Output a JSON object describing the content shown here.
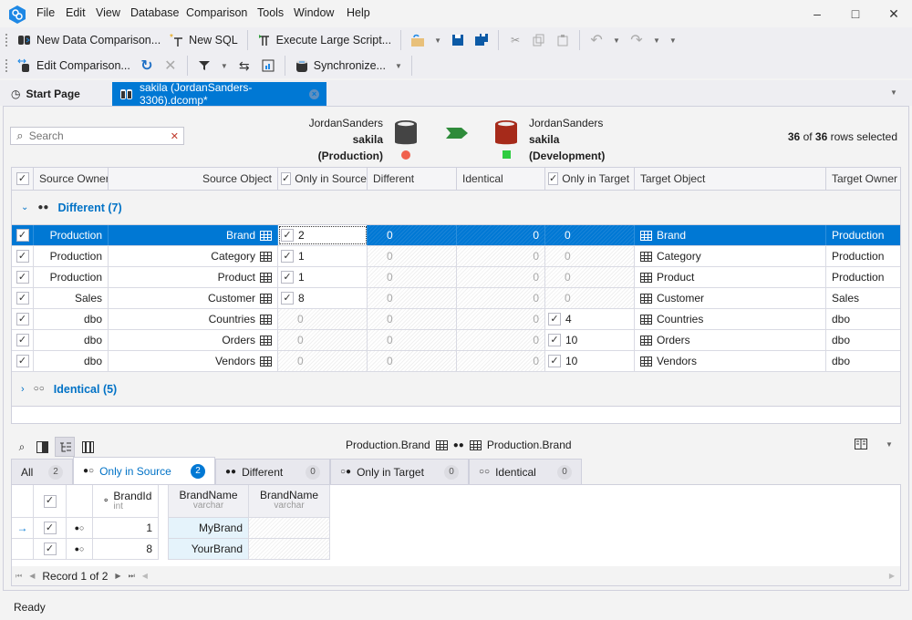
{
  "menu": [
    "File",
    "Edit",
    "View",
    "Database",
    "Comparison",
    "Tools",
    "Window",
    "Help"
  ],
  "toolbar1": {
    "new_data_comparison": "New Data Comparison...",
    "new_sql": "New SQL",
    "execute_large_script": "Execute Large Script..."
  },
  "toolbar2": {
    "edit_comparison": "Edit Comparison...",
    "synchronize": "Synchronize..."
  },
  "tabs": {
    "start_page": "Start Page",
    "active": "sakila (JordanSanders-3306).dcomp*"
  },
  "search": {
    "placeholder": "Search"
  },
  "source": {
    "server": "JordanSanders",
    "database": "sakila",
    "env": "(Production)",
    "status_color": "#f0604d"
  },
  "target": {
    "server": "JordanSanders",
    "database": "sakila",
    "env": "(Development)",
    "status_color": "#2ecc40"
  },
  "selection": {
    "selected": "36",
    "of": "of",
    "total": "36",
    "suffix": "rows selected"
  },
  "grid": {
    "headers": {
      "source_owner": "Source Owner",
      "source_object": "Source Object",
      "only_in_source": "Only in Source",
      "different": "Different",
      "identical": "Identical",
      "only_in_target": "Only in Target",
      "target_object": "Target Object",
      "target_owner": "Target Owner"
    },
    "group_different": "Different (7)",
    "group_identical": "Identical (5)",
    "rows": [
      {
        "source_owner": "Production",
        "source_object": "Brand",
        "only_in_source": "2",
        "src_checked": true,
        "different": "0",
        "identical": "0",
        "only_in_target": "0",
        "tgt_checked": false,
        "target_object": "Brand",
        "target_owner": "Production"
      },
      {
        "source_owner": "Production",
        "source_object": "Category",
        "only_in_source": "1",
        "src_checked": true,
        "different": "0",
        "identical": "0",
        "only_in_target": "0",
        "tgt_checked": false,
        "target_object": "Category",
        "target_owner": "Production"
      },
      {
        "source_owner": "Production",
        "source_object": "Product",
        "only_in_source": "1",
        "src_checked": true,
        "different": "0",
        "identical": "0",
        "only_in_target": "0",
        "tgt_checked": false,
        "target_object": "Product",
        "target_owner": "Production"
      },
      {
        "source_owner": "Sales",
        "source_object": "Customer",
        "only_in_source": "8",
        "src_checked": true,
        "different": "0",
        "identical": "0",
        "only_in_target": "0",
        "tgt_checked": false,
        "target_object": "Customer",
        "target_owner": "Sales"
      },
      {
        "source_owner": "dbo",
        "source_object": "Countries",
        "only_in_source": "0",
        "src_checked": false,
        "different": "0",
        "identical": "0",
        "only_in_target": "4",
        "tgt_checked": true,
        "target_object": "Countries",
        "target_owner": "dbo"
      },
      {
        "source_owner": "dbo",
        "source_object": "Orders",
        "only_in_source": "0",
        "src_checked": false,
        "different": "0",
        "identical": "0",
        "only_in_target": "10",
        "tgt_checked": true,
        "target_object": "Orders",
        "target_owner": "dbo"
      },
      {
        "source_owner": "dbo",
        "source_object": "Vendors",
        "only_in_source": "0",
        "src_checked": false,
        "different": "0",
        "identical": "0",
        "only_in_target": "10",
        "tgt_checked": true,
        "target_object": "Vendors",
        "target_owner": "dbo"
      }
    ]
  },
  "details": {
    "source_table": "Production.Brand",
    "target_table": "Production.Brand",
    "tabs": [
      {
        "label": "All",
        "count": "2"
      },
      {
        "label": "Only in Source",
        "count": "2"
      },
      {
        "label": "Different",
        "count": "0"
      },
      {
        "label": "Only in Target",
        "count": "0"
      },
      {
        "label": "Identical",
        "count": "0"
      }
    ],
    "columns": [
      {
        "name": "BrandId",
        "type": "int"
      },
      {
        "name": "BrandName",
        "type": "varchar"
      },
      {
        "name": "BrandName",
        "type": "varchar"
      }
    ],
    "rows": [
      {
        "id": "1",
        "source_name": "MyBrand",
        "target_name": ""
      },
      {
        "id": "8",
        "source_name": "YourBrand",
        "target_name": ""
      }
    ],
    "navigator": "Record 1 of 2"
  },
  "status": "Ready",
  "colors": {
    "accent": "#0078d4",
    "group_text": "#0072c6"
  }
}
